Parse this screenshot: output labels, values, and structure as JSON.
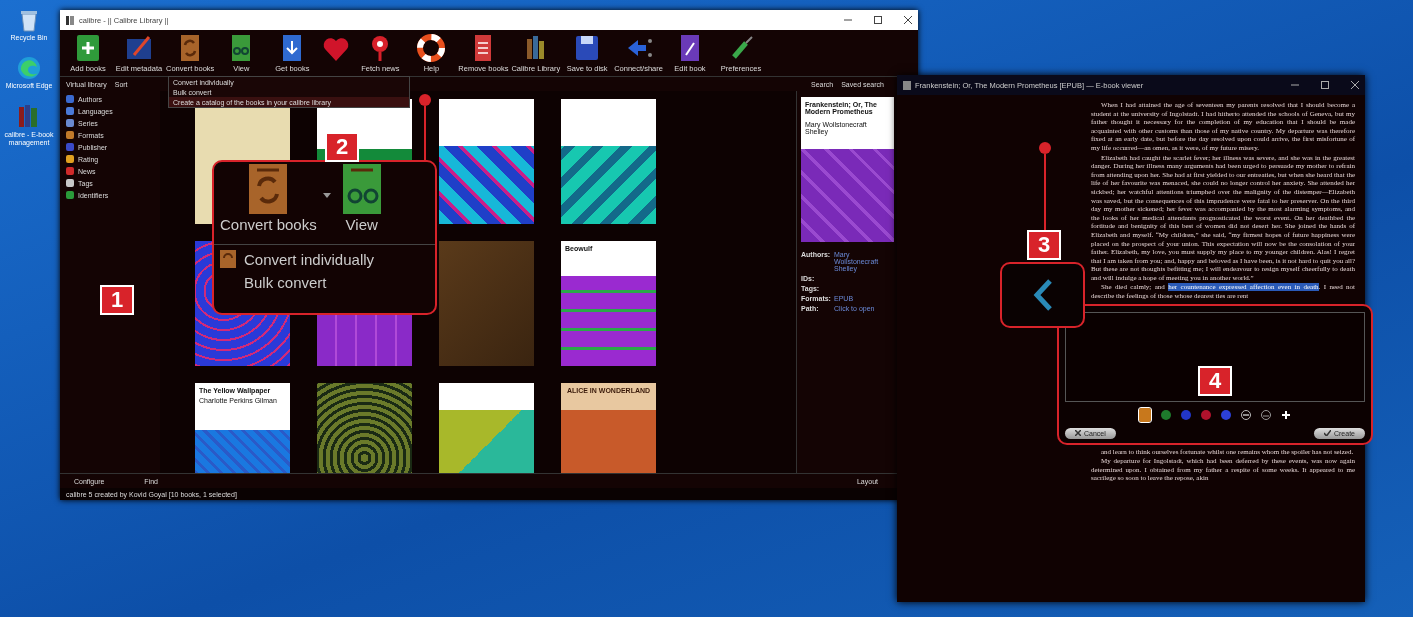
{
  "desktop_icons": [
    {
      "kind": "recycle",
      "label": "Recycle Bin"
    },
    {
      "kind": "edge",
      "label": "Microsoft Edge"
    },
    {
      "kind": "books",
      "label": "calibre - E-book management"
    }
  ],
  "library_window": {
    "title": "calibre - || Calibre Library ||",
    "toolbar": [
      {
        "kind": "add",
        "label": "Add books"
      },
      {
        "kind": "edit",
        "label": "Edit metadata"
      },
      {
        "kind": "convert",
        "label": "Convert books"
      },
      {
        "kind": "view",
        "label": "View"
      },
      {
        "kind": "get",
        "label": "Get books"
      },
      {
        "kind": "heart"
      },
      {
        "kind": "news",
        "label": "Fetch news"
      },
      {
        "kind": "help",
        "label": "Help"
      },
      {
        "kind": "remove",
        "label": "Remove books"
      },
      {
        "kind": "library",
        "label": "Calibre Library"
      },
      {
        "kind": "save",
        "label": "Save to disk"
      },
      {
        "kind": "connect",
        "label": "Connect/share"
      },
      {
        "kind": "editbook",
        "label": "Edit book"
      },
      {
        "kind": "prefs",
        "label": "Preferences"
      }
    ],
    "virtual_library": "Virtual library",
    "sort": "Sort",
    "convert_menu": [
      {
        "label": "Convert individually",
        "selected": false
      },
      {
        "label": "Bulk convert",
        "selected": false
      },
      {
        "label": "Create a catalog of the books in your calibre library",
        "selected": true
      }
    ],
    "search": "Search",
    "saved_search": "Saved search",
    "tag_browser": [
      {
        "kind": "authors",
        "label": "Authors"
      },
      {
        "kind": "languages",
        "label": "Languages"
      },
      {
        "kind": "series",
        "label": "Series"
      },
      {
        "kind": "formats",
        "label": "Formats"
      },
      {
        "kind": "publisher",
        "label": "Publisher"
      },
      {
        "kind": "rating",
        "label": "Rating"
      },
      {
        "kind": "news",
        "label": "News"
      },
      {
        "kind": "tags",
        "label": "Tags"
      },
      {
        "kind": "identifiers",
        "label": "Identifiers"
      }
    ],
    "books": [
      {
        "kind": "illustration"
      },
      {
        "kind": "white-green"
      },
      {
        "kind": "cyan-pattern"
      },
      {
        "kind": "green-pattern"
      },
      {
        "kind": "blue-pattern"
      },
      {
        "kind": "purple-pattern"
      },
      {
        "kind": "leather"
      },
      {
        "kind": "beowulf",
        "title": "Beowulf"
      },
      {
        "kind": "wallpaper",
        "title": "The Yellow Wallpaper",
        "author": "Charlotte Perkins Gilman"
      },
      {
        "kind": "peacock"
      },
      {
        "kind": "autumn"
      },
      {
        "kind": "alice",
        "title": "ALICE IN WONDERLAND"
      }
    ],
    "details": {
      "title": "Frankenstein; Or, The Modern Prometheus",
      "author": "Mary Wollstonecraft Shelley",
      "fields": [
        {
          "label": "Authors:",
          "value": "Mary Wollstonecraft Shelley"
        },
        {
          "label": "IDs:"
        },
        {
          "label": "Tags:"
        },
        {
          "label": "Formats:",
          "value": "EPUB"
        },
        {
          "label": "Path:",
          "value": "Click to open"
        }
      ]
    },
    "configure": "Configure",
    "find": "Find",
    "layout": "Layout",
    "status": "calibre 5 created by Kovid Goyal  [10 books, 1 selected]"
  },
  "convert_zoom": {
    "number": "2",
    "buttons": [
      {
        "kind": "convert",
        "label": "Convert books"
      },
      {
        "kind": "view",
        "label": "View"
      }
    ],
    "menu": [
      "Convert individually",
      "Bulk convert"
    ]
  },
  "library_callout": "1",
  "navigation_callout": "3",
  "viewer_window": {
    "title": "Frankenstein; Or, The Modern Prometheus [EPUB] — E-book viewer",
    "paragraphs": [
      {
        "text": "When I had attained the age of seventeen my parents resolved that I should become a student at the university of Ingolstadt. I had hitherto attended the schools of Geneva, but my father thought it necessary for the completion of my education that I should be made acquainted with other customs than those of my native country. My departure was therefore fixed at an early date, but before the day resolved upon could arrive, the first misfortune of my life occurred—an omen, as it were, of my future misery."
      },
      {
        "text": "Elizabeth had caught the scarlet fever; her illness was severe, and she was in the greatest danger. During her illness many arguments had been urged to persuade my mother to refrain from attending upon her. She had at first yielded to our entreaties, but when she heard that the life of her favourite was menaced, she could no longer control her anxiety. She attended her sickbed; her watchful attentions triumphed over the malignity of the distemper—Elizabeth was saved, but the consequences of this imprudence were fatal to her preserver. On the third day my mother sickened; her fever was accompanied by the most alarming symptoms, and the looks of her medical attendants prognosticated the worst event. On her deathbed the fortitude and benignity of this best of women did not desert her. She joined the hands of Elizabeth and myself. “My children,” she said, “my firmest hopes of future happiness were placed on the prospect of your union. This expectation will now be the consolation of your father. Elizabeth, my love, you must supply my place to my younger children. Alas! I regret that I am taken from you; and, happy and beloved as I have been, is it not hard to quit you all? But these are not thoughts befitting me; I will endeavour to resign myself cheerfully to death and will indulge a hope of meeting you in another world.”"
      },
      {
        "text": "She died calmly; and ",
        "highlighted": "her countenance expressed affection even in death",
        "text_after": ". I need not describe the feelings of those whose dearest ties are rent"
      }
    ],
    "annotation": {
      "number": "4",
      "swatches": [
        {
          "kind": "color",
          "color": "#c8781c",
          "selected": true
        },
        {
          "kind": "color",
          "color": "#1e7a2c",
          "selected": false
        },
        {
          "kind": "color",
          "color": "#2236c8",
          "selected": false
        },
        {
          "kind": "color",
          "color": "#b0122c",
          "selected": false
        },
        {
          "kind": "color",
          "color": "#2c40d8",
          "selected": false
        },
        {
          "kind": "strikeout"
        },
        {
          "kind": "underline"
        },
        {
          "kind": "add"
        }
      ],
      "cancel": "Cancel",
      "create": "Create"
    },
    "paragraphs_after": [
      {
        "text": "and learn to think ourselves fortunate whilst one remains whom the spoiler has not seized."
      },
      {
        "text": "My departure for Ingolstadt, which had been deferred by these events, was now again determined upon. I obtained from my father a respite of some weeks. It appeared to me sacrilege so soon to leave the repose, akin"
      }
    ]
  }
}
